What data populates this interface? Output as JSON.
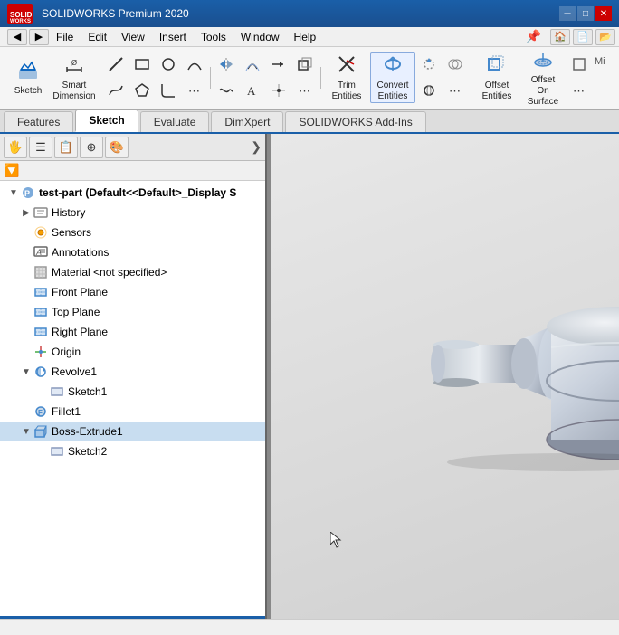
{
  "titlebar": {
    "logo_text": "SW",
    "title": "SOLIDWORKS",
    "app_name": "SOLIDWORKS Premium 2020",
    "min_btn": "─",
    "max_btn": "□",
    "close_btn": "✕"
  },
  "menubar": {
    "items": [
      "File",
      "Edit",
      "View",
      "Insert",
      "Tools",
      "Window",
      "Help"
    ],
    "pin_icon": "📌"
  },
  "toolbar": {
    "top_row": {
      "sketch_label": "Sketch",
      "smart_dim_label": "Smart\nDimension",
      "trim_label": "Trim\nEntities",
      "convert_label": "Convert\nEntities",
      "offset_entities_label": "Offset\nEntities",
      "offset_surface_label": "Offset On\nSurface"
    }
  },
  "tabs": [
    {
      "id": "features",
      "label": "Features"
    },
    {
      "id": "sketch",
      "label": "Sketch",
      "active": true
    },
    {
      "id": "evaluate",
      "label": "Evaluate"
    },
    {
      "id": "dimxpert",
      "label": "DimXpert"
    },
    {
      "id": "addins",
      "label": "SOLIDWORKS Add-Ins"
    }
  ],
  "panel": {
    "toolbar_icons": [
      "🖐",
      "☰",
      "📋",
      "⊕",
      "🎨"
    ],
    "expand_icon": "❯",
    "filter_icon": "🔽",
    "tree": {
      "root": {
        "icon": "🔧",
        "label": "test-part  (Default<<Default>_Display S",
        "expand": "▼"
      },
      "items": [
        {
          "id": "history",
          "icon": "📂",
          "label": "History",
          "expand": "▶",
          "indent": 1
        },
        {
          "id": "sensors",
          "icon": "📡",
          "label": "Sensors",
          "expand": "",
          "indent": 1
        },
        {
          "id": "annotations",
          "icon": "📝",
          "label": "Annotations",
          "expand": "",
          "indent": 1
        },
        {
          "id": "material",
          "icon": "🔲",
          "label": "Material <not specified>",
          "expand": "",
          "indent": 1
        },
        {
          "id": "front-plane",
          "icon": "▭",
          "label": "Front Plane",
          "expand": "",
          "indent": 1
        },
        {
          "id": "top-plane",
          "icon": "▭",
          "label": "Top Plane",
          "expand": "",
          "indent": 1
        },
        {
          "id": "right-plane",
          "icon": "▭",
          "label": "Right Plane",
          "expand": "",
          "indent": 1
        },
        {
          "id": "origin",
          "icon": "✚",
          "label": "Origin",
          "expand": "",
          "indent": 1
        },
        {
          "id": "revolve1",
          "icon": "🔄",
          "label": "Revolve1",
          "expand": "▼",
          "indent": 1
        },
        {
          "id": "sketch1",
          "icon": "▭",
          "label": "Sketch1",
          "expand": "",
          "indent": 2
        },
        {
          "id": "fillet1",
          "icon": "🔲",
          "label": "Fillet1",
          "expand": "",
          "indent": 1
        },
        {
          "id": "boss-extrude1",
          "icon": "📦",
          "label": "Boss-Extrude1",
          "expand": "▼",
          "indent": 1,
          "selected": true
        },
        {
          "id": "sketch2",
          "icon": "▭",
          "label": "Sketch2",
          "expand": "",
          "indent": 2
        }
      ]
    }
  },
  "view": {
    "background_start": "#e0e0e0",
    "background_end": "#c8c8c8"
  },
  "statusbar": {
    "text": ""
  }
}
